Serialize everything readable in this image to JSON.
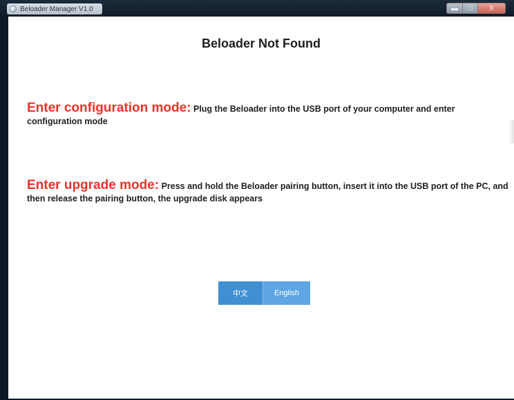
{
  "window": {
    "title": "Beloader Manager V1.0",
    "controls": {
      "minimize_glyph": "▬",
      "maximize_glyph": "□",
      "close_glyph": "X"
    }
  },
  "main": {
    "heading": "Beloader Not Found",
    "config": {
      "mode_label": "Enter configuration mode:",
      "description": "Plug the Beloader into the USB port of your computer and enter configuration mode"
    },
    "upgrade": {
      "mode_label": "Enter upgrade mode:",
      "description": "Press and hold the Beloader pairing button, insert it into the USB port of the PC, and then release the pairing button, the upgrade disk appears"
    },
    "languages": {
      "chinese": "中文",
      "english": "English"
    }
  },
  "colors": {
    "mode_label": "#e8332b",
    "button_primary": "#3f8fd2",
    "button_secondary": "#5da6e3"
  }
}
